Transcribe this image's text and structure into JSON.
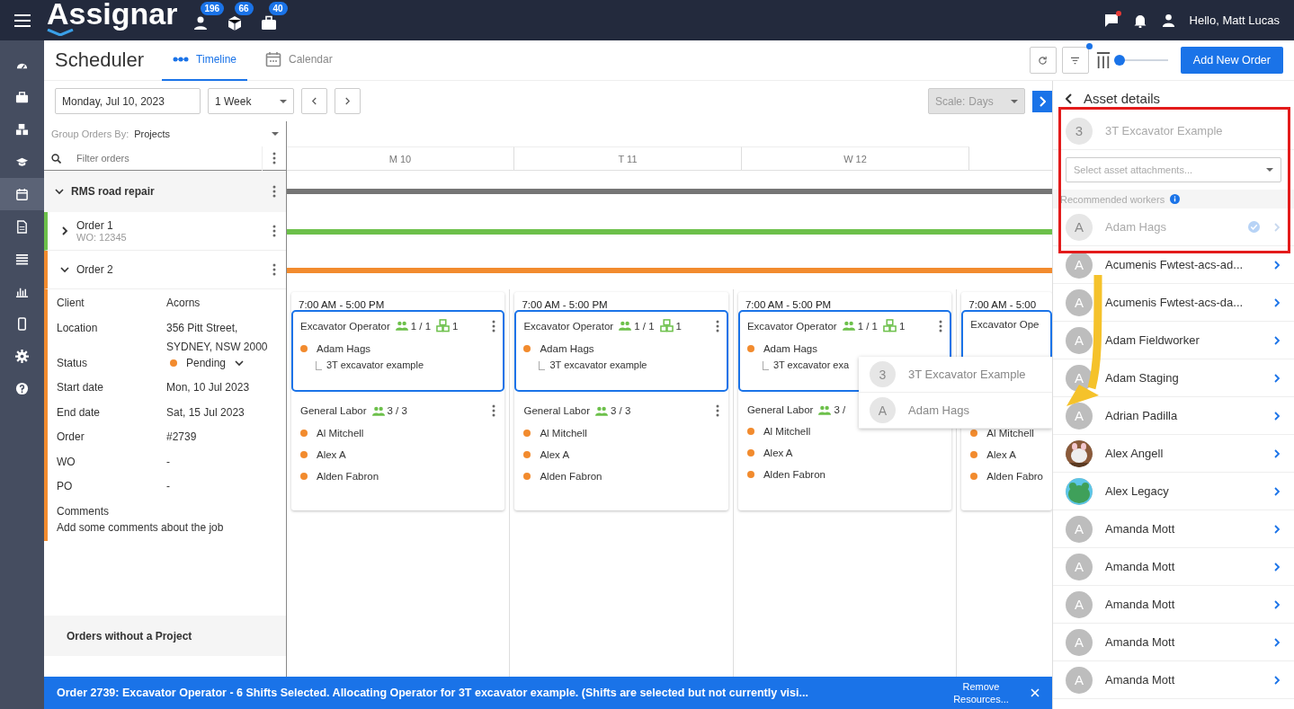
{
  "topbar": {
    "logo": "Assignar",
    "counters": [
      {
        "count": "196"
      },
      {
        "count": "66"
      },
      {
        "count": "40"
      }
    ],
    "chat_unread": true,
    "greeting": "Hello, Matt Lucas"
  },
  "nav": [
    {
      "selected": false
    },
    {
      "selected": false
    },
    {
      "selected": false
    },
    {
      "selected": false
    },
    {
      "selected": true
    },
    {
      "selected": false
    },
    {
      "selected": false
    },
    {
      "selected": false
    },
    {
      "selected": false
    },
    {
      "selected": false
    },
    {
      "selected": false
    }
  ],
  "header": {
    "title": "Scheduler",
    "tabs": [
      {
        "label": "Timeline",
        "selected": true
      },
      {
        "label": "Calendar",
        "selected": false
      }
    ],
    "filter_active": true,
    "zoom": {
      "level": 0
    },
    "add_button": "Add New Order"
  },
  "toolbar": {
    "date": "Monday, Jul 10, 2023",
    "range": "1 Week",
    "scale_label": "Scale:",
    "scale": "Days",
    "scale_disabled": true
  },
  "orders_panel": {
    "group_label": "Group Orders By:",
    "group_value": "Projects",
    "filter_placeholder": "Filter orders",
    "project": {
      "name": "RMS road repair",
      "expanded": true,
      "color": "#757575"
    },
    "orders": [
      {
        "title": "Order 1",
        "subtitle": "WO: 12345",
        "expanded": false,
        "color": "#6cc04a"
      },
      {
        "title": "Order 2",
        "expanded": true,
        "color": "#f28b2e",
        "details": [
          {
            "kind": "text",
            "label": "Client",
            "value": "Acorns"
          },
          {
            "kind": "lines",
            "label": "Location",
            "lines": [
              "356 Pitt Street,",
              "SYDNEY, NSW 2000"
            ]
          },
          {
            "kind": "status",
            "label": "Status",
            "value": "Pending",
            "color": "#f28b2e"
          },
          {
            "kind": "text",
            "label": "Start date",
            "value": "Mon, 10 Jul 2023"
          },
          {
            "kind": "text",
            "label": "End date",
            "value": "Sat, 15 Jul 2023"
          },
          {
            "kind": "text",
            "label": "Order",
            "value": "#2739"
          },
          {
            "kind": "text",
            "label": "WO",
            "value": "-"
          },
          {
            "kind": "text",
            "label": "PO",
            "value": "-"
          }
        ],
        "comments": {
          "label": "Comments",
          "text": "Add some comments about the job"
        }
      }
    ],
    "no_project": "Orders without a Project"
  },
  "timeline": {
    "days": [
      "M 10",
      "T 11",
      "W 12"
    ],
    "cards": [
      {
        "time": "7:00 AM - 5:00 PM",
        "roles": [
          {
            "name": "Excavator Operator",
            "count": "1 / 1",
            "assets": "1",
            "menu": true,
            "selected": true,
            "workers": [
              {
                "name": "Adam Hags",
                "asset": "3T excavator example"
              }
            ]
          },
          {
            "name": "General Labor",
            "count": "3 / 3",
            "menu": true,
            "selected": false,
            "workers": [
              {
                "name": "Al Mitchell"
              },
              {
                "name": "Alex A"
              },
              {
                "name": "Alden Fabron"
              }
            ]
          }
        ]
      },
      {
        "time": "7:00 AM - 5:00 PM",
        "roles": [
          {
            "name": "Excavator Operator",
            "count": "1 / 1",
            "assets": "1",
            "menu": true,
            "selected": true,
            "workers": [
              {
                "name": "Adam Hags",
                "asset": "3T excavator example"
              }
            ]
          },
          {
            "name": "General Labor",
            "count": "3 / 3",
            "menu": true,
            "selected": false,
            "workers": [
              {
                "name": "Al Mitchell"
              },
              {
                "name": "Alex A"
              },
              {
                "name": "Alden Fabron"
              }
            ]
          }
        ]
      },
      {
        "time": "7:00 AM - 5:00 PM",
        "roles": [
          {
            "name": "Excavator Operator",
            "count": "1 / 1",
            "assets": "1",
            "menu": true,
            "selected": true,
            "workers": [
              {
                "name": "Adam Hags",
                "asset": "3T excavator exa"
              }
            ]
          },
          {
            "name": "General Labor",
            "count": "3 /",
            "menu": false,
            "selected": false,
            "workers": [
              {
                "name": "Al Mitchell"
              },
              {
                "name": "Alex A"
              },
              {
                "name": "Alden Fabron"
              }
            ]
          }
        ]
      },
      {
        "time": "7:00 AM - 5:00",
        "roles": [
          {
            "name": "Excavator Ope",
            "menu": false,
            "selected": true
          },
          {
            "selected": false,
            "workers": [
              {
                "name": "Al Mitchell"
              },
              {
                "name": "Alex A"
              },
              {
                "name": "Alden Fabro"
              }
            ]
          }
        ]
      }
    ],
    "drag_preview": [
      {
        "initial": "3",
        "name": "3T Excavator Example"
      },
      {
        "initial": "A",
        "name": "Adam Hags"
      }
    ]
  },
  "asset_panel": {
    "title": "Asset details",
    "asset": {
      "initial": "3",
      "name": "3T Excavator Example"
    },
    "attachments_placeholder": "Select asset attachments...",
    "recommended_label": "Recommended workers",
    "recommended": [
      {
        "initial": "A",
        "name": "Adam Hags",
        "checked": true
      }
    ],
    "workers": [
      {
        "kind": "initial",
        "initial": "A",
        "name": "Acumenis Fwtest-acs-ad..."
      },
      {
        "kind": "initial",
        "initial": "A",
        "name": "Acumenis Fwtest-acs-da..."
      },
      {
        "kind": "initial",
        "initial": "A",
        "name": "Adam Fieldworker"
      },
      {
        "kind": "initial",
        "initial": "A",
        "name": "Adam Staging"
      },
      {
        "kind": "initial",
        "initial": "A",
        "name": "Adrian Padilla"
      },
      {
        "kind": "picture",
        "name": "Alex Angell",
        "color": "#8a5a3a"
      },
      {
        "kind": "picture",
        "name": "Alex Legacy",
        "color": "#5cc6e8"
      },
      {
        "kind": "initial",
        "initial": "A",
        "name": "Amanda Mott"
      },
      {
        "kind": "initial",
        "initial": "A",
        "name": "Amanda Mott"
      },
      {
        "kind": "initial",
        "initial": "A",
        "name": "Amanda Mott"
      },
      {
        "kind": "initial",
        "initial": "A",
        "name": "Amanda Mott"
      },
      {
        "kind": "initial",
        "initial": "A",
        "name": "Amanda Mott"
      }
    ]
  },
  "selection_bar": {
    "message": "Order 2739: Excavator Operator - 6 Shifts Selected. Allocating Operator for 3T excavator example. (Shifts are selected but not currently visi...",
    "action": "Remove Resources..."
  }
}
